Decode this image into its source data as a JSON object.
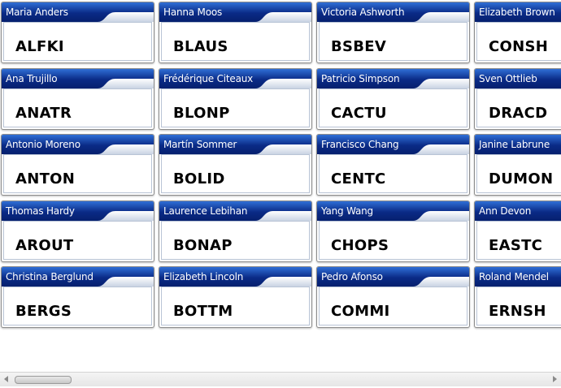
{
  "cards": [
    {
      "name": "Maria Anders",
      "code": "ALFKI"
    },
    {
      "name": "Ana Trujillo",
      "code": "ANATR"
    },
    {
      "name": "Antonio Moreno",
      "code": "ANTON"
    },
    {
      "name": "Thomas Hardy",
      "code": "AROUT"
    },
    {
      "name": "Christina Berglund",
      "code": "BERGS"
    },
    {
      "name": "Hanna Moos",
      "code": "BLAUS"
    },
    {
      "name": "Frédérique Citeaux",
      "code": "BLONP"
    },
    {
      "name": "Martín Sommer",
      "code": "BOLID"
    },
    {
      "name": "Laurence Lebihan",
      "code": "BONAP"
    },
    {
      "name": "Elizabeth Lincoln",
      "code": "BOTTM"
    },
    {
      "name": "Victoria Ashworth",
      "code": "BSBEV"
    },
    {
      "name": "Patricio Simpson",
      "code": "CACTU"
    },
    {
      "name": "Francisco Chang",
      "code": "CENTC"
    },
    {
      "name": "Yang Wang",
      "code": "CHOPS"
    },
    {
      "name": "Pedro Afonso",
      "code": "COMMI"
    },
    {
      "name": "Elizabeth Brown",
      "code": "CONSH"
    },
    {
      "name": "Sven Ottlieb",
      "code": "DRACD"
    },
    {
      "name": "Janine Labrune",
      "code": "DUMON"
    },
    {
      "name": "Ann Devon",
      "code": "EASTC"
    },
    {
      "name": "Roland Mendel",
      "code": "ERNSH"
    }
  ],
  "colors": {
    "header_dark": "#0a2a86",
    "header_light": "#2f6fd6",
    "header_sheen": "#c9d3e3"
  },
  "icons": {
    "scroll_left": "triangle-left-icon",
    "scroll_right": "triangle-right-icon"
  }
}
